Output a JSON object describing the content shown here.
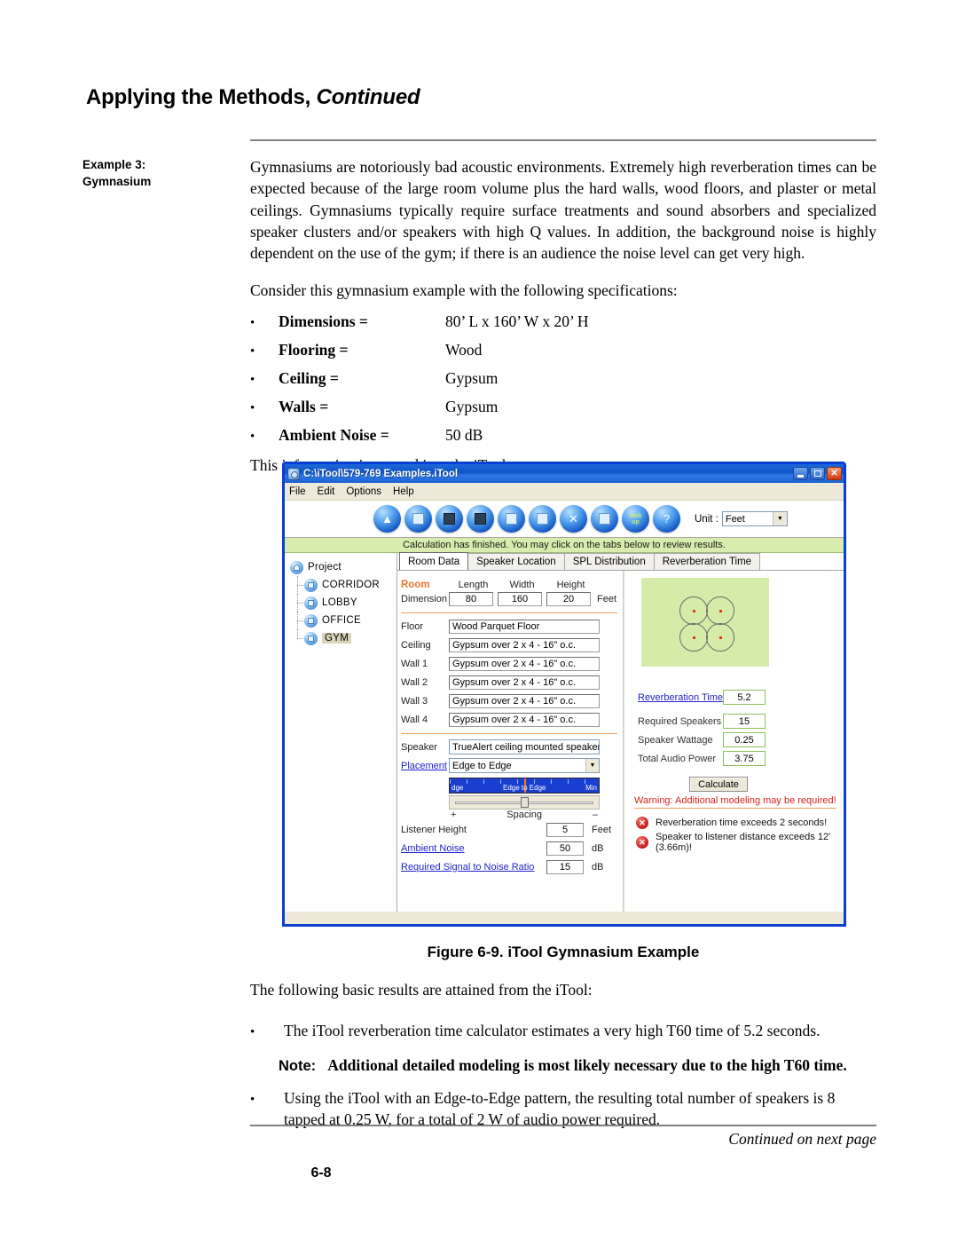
{
  "header": {
    "title_main": "Applying the Methods,",
    "title_continued": "Continued"
  },
  "margin": {
    "label_line1": "Example 3:",
    "label_line2": "Gymnasium"
  },
  "body": {
    "intro_paragraph": "Gymnasiums are notoriously bad acoustic environments.  Extremely high reverberation times can be expected because of the large room volume plus the hard walls, wood floors, and plaster or metal ceilings.  Gymnasiums typically require surface treatments and sound absorbers and specialized speaker clusters and/or speakers with high Q values.  In addition, the background noise is highly dependent on the use of the gym; if there is an audience the noise level can get very high.",
    "consider_line": "Consider this gymnasium example with the following specifications:",
    "spec_bullet": "•",
    "specs": [
      {
        "term": "Dimensions =",
        "value": "80’ L x 160’ W x 20’ H"
      },
      {
        "term": "Flooring =",
        "value": "Wood"
      },
      {
        "term": "Ceiling =",
        "value": "Gypsum"
      },
      {
        "term": "Walls =",
        "value": "Gypsum"
      },
      {
        "term": "Ambient Noise =",
        "value": "50 dB"
      }
    ],
    "entered_line": "This information is entered into the iTool:",
    "figure_caption": "Figure 6-9.  iTool Gymnasium Example",
    "results_intro": "The following basic results are attained from the iTool:",
    "result_bullet_1": "The iTool reverberation time calculator estimates a very high T60 time of 5.2 seconds.",
    "note_keyword": "Note:",
    "note_text": "Additional detailed modeling is most likely necessary due to the high T60 time.",
    "result_bullet_2": "Using the iTool with an Edge-to-Edge pattern, the resulting total number of speakers is 8 tapped at 0.25 W, for a total of 2 W of audio power required."
  },
  "footer": {
    "continued": "Continued on next page",
    "page_number": "6-8"
  },
  "itool": {
    "titlebar": {
      "title": "C:\\iTool\\579-769 Examples.iTool",
      "minimize": "–",
      "maximize": "□",
      "close": "✕"
    },
    "menu": [
      "File",
      "Edit",
      "Options",
      "Help"
    ],
    "toolbar": {
      "icons": [
        "new-project-icon",
        "open-project-icon",
        "save-icon",
        "print-icon",
        "copy-icon",
        "paste-icon",
        "delete-icon",
        "properties-icon",
        "web-update-icon",
        "help-icon"
      ],
      "web_update_line1": "web",
      "web_update_line2": "up",
      "unit_label": "Unit :",
      "unit_value": "Feet"
    },
    "status_message": "Calculation has finished. You may click on the tabs below to review results.",
    "tree": {
      "root": "Project",
      "children": [
        "CORRIDOR",
        "LOBBY",
        "OFFICE",
        "GYM"
      ],
      "selected": "GYM"
    },
    "tabs": [
      {
        "label": "Room Data",
        "active": true
      },
      {
        "label": "Speaker Location",
        "active": false
      },
      {
        "label": "SPL Distribution",
        "active": false
      },
      {
        "label": "Reverberation Time",
        "active": false
      }
    ],
    "room_data": {
      "room_label": "Room",
      "dimension_label": "Dimension",
      "col_length": "Length",
      "col_width": "Width",
      "col_height": "Height",
      "length": "80",
      "width": "160",
      "height": "20",
      "dim_unit": "Feet",
      "surfaces": [
        {
          "label": "Floor",
          "value": "Wood Parquet Floor"
        },
        {
          "label": "Ceiling",
          "value": "Gypsum over 2 x 4 - 16\" o.c."
        },
        {
          "label": "Wall 1",
          "value": "Gypsum over 2 x 4 - 16\" o.c."
        },
        {
          "label": "Wall 2",
          "value": "Gypsum over 2 x 4 - 16\" o.c."
        },
        {
          "label": "Wall 3",
          "value": "Gypsum over 2 x 4 - 16\" o.c."
        },
        {
          "label": "Wall 4",
          "value": "Gypsum over 2 x 4 - 16\" o.c."
        }
      ],
      "speaker_label": "Speaker",
      "speaker_value": "TrueAlert ceiling mounted speaker",
      "placement_label": "Placement",
      "placement_value": "Edge to Edge",
      "slider": {
        "left_label": "dge",
        "center_label": "Edge to Edge",
        "right_label": "Min",
        "plus": "+",
        "minus": "–",
        "caption": "Spacing"
      },
      "options": [
        {
          "label": "Listener Height",
          "value": "5",
          "unit": "Feet",
          "link": false
        },
        {
          "label": "Ambient Noise",
          "value": "50",
          "unit": "dB",
          "link": true
        },
        {
          "label": "Required Signal to Noise Ratio",
          "value": "15",
          "unit": "dB",
          "link": true
        }
      ]
    },
    "results": {
      "reverberation_label": "Reverberation Time",
      "reverberation_value": "5.2",
      "rows": [
        {
          "label": "Required Speakers",
          "value": "15"
        },
        {
          "label": "Speaker Wattage",
          "value": "0.25"
        },
        {
          "label": "Total Audio Power",
          "value": "3.75"
        }
      ],
      "calculate_button": "Calculate",
      "warning_header": "Warning: Additional modeling may be required!",
      "warning_icon_glyph": "✕",
      "warnings": [
        "Reverberation time exceeds 2 seconds!",
        "Speaker to listener distance exceeds 12' (3.66m)!"
      ]
    },
    "colors": {
      "titlebar_blue": "#0f51c9",
      "window_border": "#0a3fd4",
      "status_green": "#d7ecad",
      "room_accent_orange": "#e8762a",
      "warning_red": "#e02020",
      "link_blue": "#2222cc",
      "result_border_green": "#8fbf5a",
      "diagram_green": "#d4eca8"
    }
  }
}
